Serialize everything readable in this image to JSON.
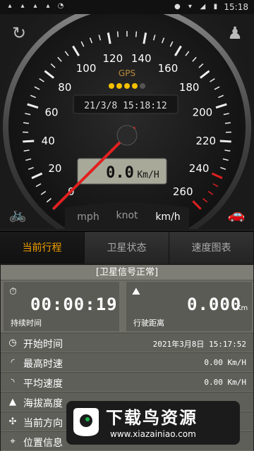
{
  "status_bar": {
    "time": "15:18",
    "icons": [
      "notification-icon",
      "notification-icon",
      "notification-icon",
      "notification-icon",
      "nfc-icon",
      "location-icon",
      "wifi-icon",
      "signal-icon",
      "battery-icon"
    ]
  },
  "gauge": {
    "gps_label": "GPS",
    "datetime": "21/3/8 15:18:12",
    "speed_display": "0.0",
    "speed_unit": "Km/H",
    "ticks": [
      "0",
      "20",
      "40",
      "60",
      "80",
      "100",
      "120",
      "140",
      "160",
      "180",
      "200",
      "220",
      "240",
      "260"
    ],
    "needle_value": 0,
    "max_value": 260,
    "gps_dots_active": 4,
    "gps_dots_total": 5
  },
  "units": {
    "mph": "mph",
    "knot": "knot",
    "kmh": "km/h",
    "selected": "km/h"
  },
  "tabs": [
    {
      "label": "当前行程",
      "active": true
    },
    {
      "label": "卫星状态",
      "active": false
    },
    {
      "label": "速度图表",
      "active": false
    }
  ],
  "info": {
    "signal_status": "[卫星信号正常]",
    "duration_value": "00:00:19",
    "duration_label": "持续时间",
    "distance_value": "0.000",
    "distance_unit": "Km",
    "distance_label": "行驶距离",
    "rows": [
      {
        "label": "开始时间",
        "value": "2021年3月8日 15:17:52"
      },
      {
        "label": "最高时速",
        "value": "0.00 Km/H"
      },
      {
        "label": "平均速度",
        "value": "0.00 Km/H"
      },
      {
        "label": "海拔高度",
        "value": ""
      },
      {
        "label": "当前方向",
        "value": ""
      },
      {
        "label": "位置信息",
        "value": ""
      }
    ]
  },
  "watermark": {
    "title": "下载鸟资源",
    "url": "www.xiazainiao.com"
  },
  "colors": {
    "accent": "#f5a000",
    "needle": "#e02020",
    "gps_dot": "#f5c000",
    "car_icon": "#c8e000"
  }
}
